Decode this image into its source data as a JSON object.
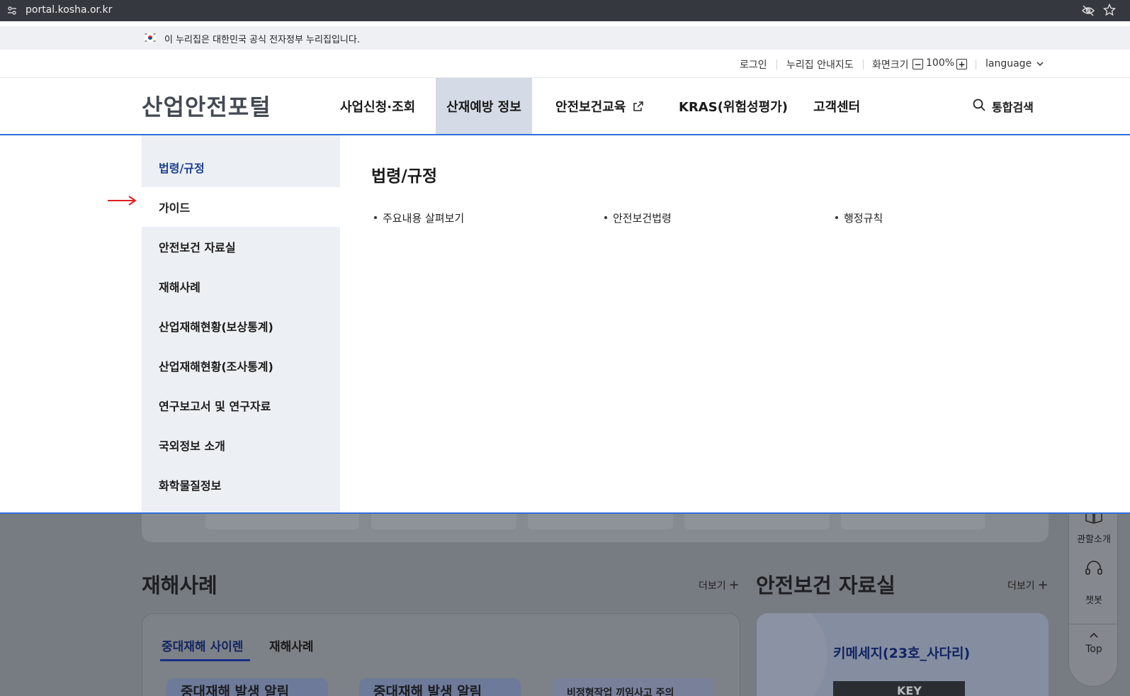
{
  "browser": {
    "url": "portal.kosha.or.kr"
  },
  "gov_banner": {
    "text": "이 누리집은 대한민국 공식 전자정부 누리집입니다."
  },
  "utility": {
    "login": "로그인",
    "sitemap": "누리집 안내지도",
    "zoom_label": "화면크기",
    "zoom_value": "100%",
    "language": "language"
  },
  "header": {
    "logo": "산업안전포털",
    "nav": [
      {
        "label": "사업신청·조회"
      },
      {
        "label": "산재예방 정보"
      },
      {
        "label": "안전보건교육"
      },
      {
        "label": "KRAS(위험성평가)"
      },
      {
        "label": "고객센터"
      }
    ],
    "search_label": "통합검색"
  },
  "mega_menu": {
    "sub_items": [
      {
        "label": "법령/규정"
      },
      {
        "label": "가이드"
      },
      {
        "label": "안전보건 자료실"
      },
      {
        "label": "재해사례"
      },
      {
        "label": "산업재해현황(보상통계)"
      },
      {
        "label": "산업재해현황(조사통계)"
      },
      {
        "label": "연구보고서 및 연구자료"
      },
      {
        "label": "국외정보 소개"
      },
      {
        "label": "화학물질정보"
      }
    ],
    "panel_title": "법령/규정",
    "panel_links": [
      {
        "label": "주요내용 살펴보기"
      },
      {
        "label": "안전보건법령"
      },
      {
        "label": "행정규칙"
      }
    ],
    "annotation_color": "#e02020"
  },
  "background": {
    "section_left_title": "재해사례",
    "section_right_title": "안전보건 자료실",
    "more_label": "더보기",
    "tabs": [
      {
        "label": "중대재해 사이렌"
      },
      {
        "label": "재해사례"
      }
    ],
    "thumb_texts": [
      "중대재해 발생 알림",
      "중대재해 발생 알림",
      "비정형작업 끼임사고 주의"
    ],
    "right_card_title": "키메세지(23호_사다리)",
    "key_thumb_text": "KEY",
    "float_menu": {
      "jurisdiction": "관할소개",
      "chatbot": "챗봇",
      "top": "Top"
    }
  },
  "colors": {
    "accent_blue": "#2f6fdc",
    "nav_active_bg": "#d4dbe6",
    "submenu_bg": "#eceff4",
    "selected_text": "#1b3f8f"
  }
}
